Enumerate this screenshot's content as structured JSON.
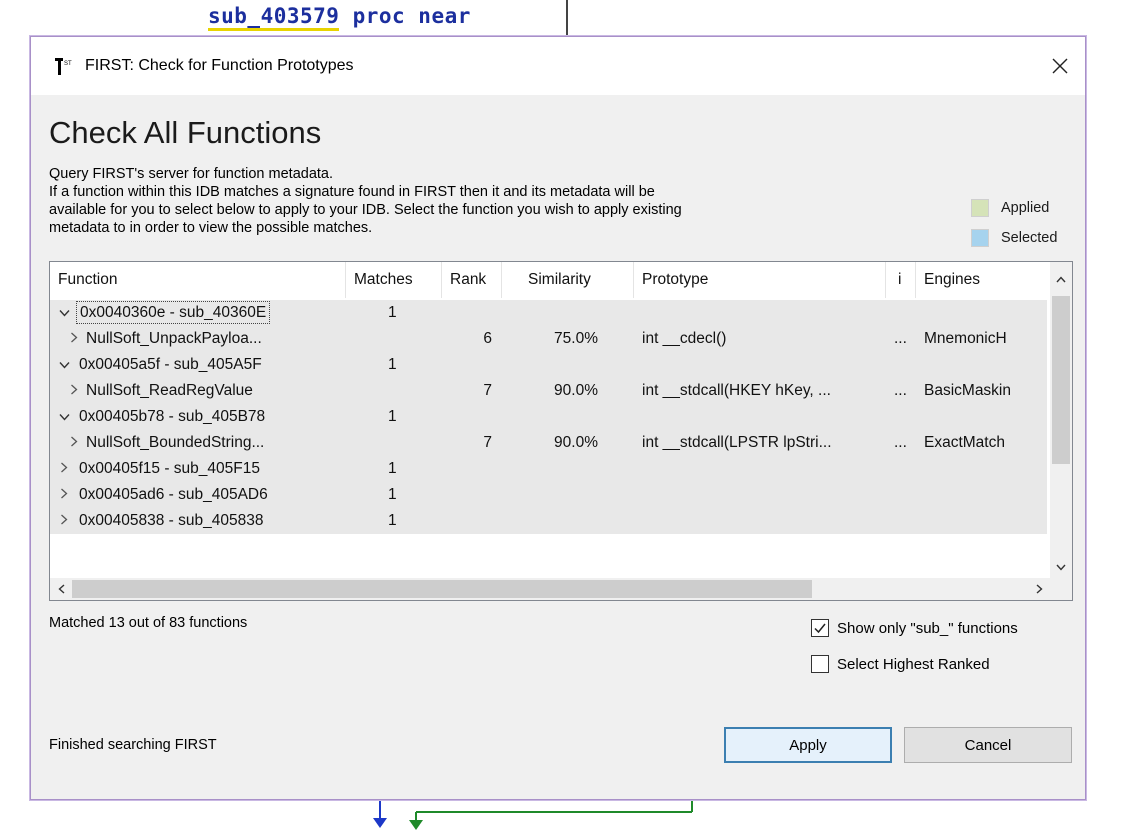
{
  "background": {
    "code_line": "sub_403579",
    "code_rest": " proc near"
  },
  "window": {
    "title": "FIRST: Check for Function Prototypes",
    "close_icon": "close-icon"
  },
  "heading": "Check All Functions",
  "description": [
    "Query FIRST's server for function metadata.",
    "If a function within this IDB matches a signature found in FIRST then it and its metadata will be",
    "available for you to select below to apply to your IDB. Select the function you wish to apply existing",
    "metadata to in order to view the possible matches."
  ],
  "legend": {
    "applied_label": "Applied",
    "applied_color": "#d5e3b8",
    "selected_label": "Selected",
    "selected_color": "#a6d3ee"
  },
  "table": {
    "columns": [
      "Function",
      "Matches",
      "Rank",
      "Similarity",
      "Prototype",
      "i",
      "Engines"
    ],
    "rows": [
      {
        "type": "parent",
        "expanded": true,
        "function": "0x0040360e - sub_40360E",
        "matches": "1",
        "rank": "",
        "similarity": "",
        "prototype": "",
        "i": "",
        "engines": ""
      },
      {
        "type": "child",
        "function": "NullSoft_UnpackPayloa...",
        "matches": "",
        "rank": "6",
        "similarity": "75.0%",
        "prototype": "int __cdecl()",
        "i": "...",
        "engines": "MnemonicH"
      },
      {
        "type": "parent",
        "expanded": true,
        "function": "0x00405a5f - sub_405A5F",
        "matches": "1",
        "rank": "",
        "similarity": "",
        "prototype": "",
        "i": "",
        "engines": ""
      },
      {
        "type": "child",
        "function": "NullSoft_ReadRegValue",
        "matches": "",
        "rank": "7",
        "similarity": "90.0%",
        "prototype": "int __stdcall(HKEY hKey, ...",
        "i": "...",
        "engines": "BasicMaskin"
      },
      {
        "type": "parent",
        "expanded": true,
        "function": "0x00405b78 - sub_405B78",
        "matches": "1",
        "rank": "",
        "similarity": "",
        "prototype": "",
        "i": "",
        "engines": ""
      },
      {
        "type": "child",
        "function": "NullSoft_BoundedString...",
        "matches": "",
        "rank": "7",
        "similarity": "90.0%",
        "prototype": "int __stdcall(LPSTR lpStri...",
        "i": "...",
        "engines": "ExactMatch"
      },
      {
        "type": "parent",
        "expanded": false,
        "function": "0x00405f15 - sub_405F15",
        "matches": "1",
        "rank": "",
        "similarity": "",
        "prototype": "",
        "i": "",
        "engines": ""
      },
      {
        "type": "parent",
        "expanded": false,
        "function": "0x00405ad6 - sub_405AD6",
        "matches": "1",
        "rank": "",
        "similarity": "",
        "prototype": "",
        "i": "",
        "engines": ""
      },
      {
        "type": "parent",
        "expanded": false,
        "function": "0x00405838 - sub_405838",
        "matches": "1",
        "rank": "",
        "similarity": "",
        "prototype": "",
        "i": "",
        "engines": ""
      }
    ]
  },
  "match_summary": "Matched 13 out of 83 functions",
  "options": {
    "show_sub_label": "Show only \"sub_\" functions",
    "show_sub_checked": true,
    "highest_label": "Select Highest Ranked",
    "highest_checked": false
  },
  "status_text": "Finished searching FIRST",
  "buttons": {
    "apply": "Apply",
    "cancel": "Cancel"
  }
}
